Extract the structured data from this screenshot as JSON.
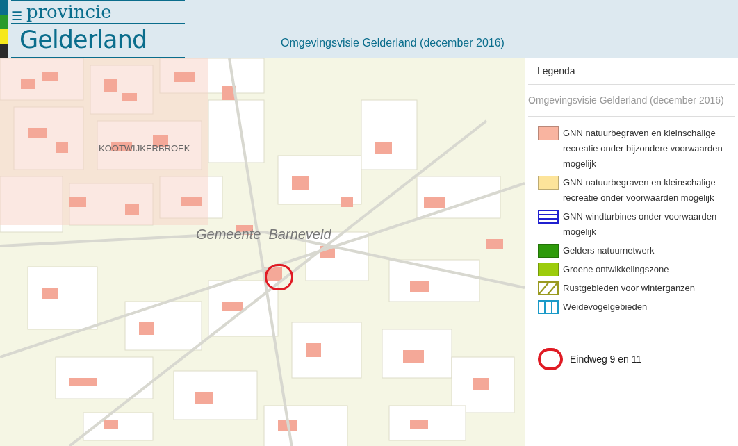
{
  "header": {
    "menu_glyph": "☰",
    "logo_top": "provincie",
    "logo_bottom": "Gelderland",
    "title": "Omgevingsvisie Gelderland (december 2016)"
  },
  "map": {
    "labels": [
      {
        "text": "KOOTWIJKERBROEK",
        "kind": "place"
      },
      {
        "text": "Gemeente  Barneveld",
        "kind": "municipality"
      }
    ]
  },
  "legend": {
    "title": "Legenda",
    "subtitle": "Omgevingsvisie Gelderland (december 2016)",
    "items": [
      {
        "kind": "fill",
        "color": "#f9b4a0",
        "label": "GNN natuurbegraven en kleinschalige recreatie onder bijzondere voorwaarden mogelijk"
      },
      {
        "kind": "fill",
        "color": "#fde49a",
        "label": "GNN natuurbegraven en kleinschalige recreatie onder voorwaarden mogelijk"
      },
      {
        "kind": "hlines",
        "color": "#2020d0",
        "label": "GNN windturbines onder voorwaarden mogelijk"
      },
      {
        "kind": "fill",
        "color": "#2e9a0a",
        "label": "Gelders natuurnetwerk"
      },
      {
        "kind": "fill",
        "color": "#9ccc0c",
        "label": "Groene ontwikkelingszone"
      },
      {
        "kind": "diagonal",
        "color": "#9a9a20",
        "label": "Rustgebieden voor winterganzen"
      },
      {
        "kind": "vlines",
        "color": "#1a9ac8",
        "label": "Weidevogelgebieden"
      }
    ],
    "marker": {
      "color": "#e01b24",
      "label": "Eindweg 9 en 11"
    }
  }
}
